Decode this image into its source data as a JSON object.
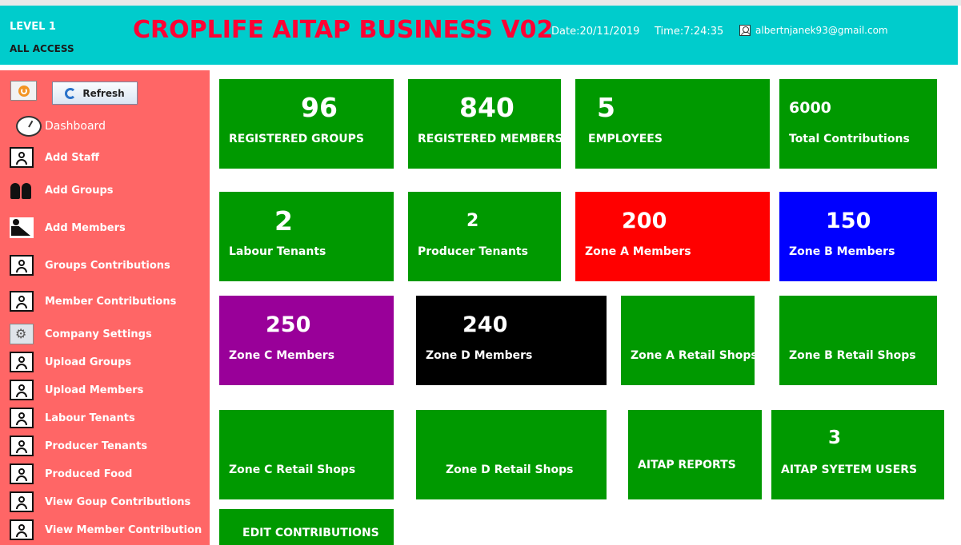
{
  "header": {
    "level": "LEVEL 1",
    "access": "ALL ACCESS",
    "title": "CROPLIFE AITAP BUSINESS V02",
    "date": "Date:20/11/2019",
    "time": "Time:7:24:35",
    "user_email": "albertnjanek93@gmail.com"
  },
  "sidebar": {
    "refresh_label": "Refresh",
    "dashboard_label": "Dashboard",
    "items": [
      {
        "label": "Add Staff",
        "icon": "folder-user-icon"
      },
      {
        "label": "Add Groups",
        "icon": "group-icon"
      },
      {
        "label": "Add Members",
        "icon": "worker-icon"
      },
      {
        "label": "Groups Contributions",
        "icon": "folder-user-icon"
      },
      {
        "label": "Member Contributions",
        "icon": "folder-user-icon"
      },
      {
        "label": "Company Settings",
        "icon": "gear-icon"
      },
      {
        "label": "Upload Groups",
        "icon": "folder-user-icon"
      },
      {
        "label": "Upload Members",
        "icon": "folder-user-icon"
      },
      {
        "label": "Labour Tenants",
        "icon": "folder-user-icon"
      },
      {
        "label": "Producer Tenants",
        "icon": "folder-user-icon"
      },
      {
        "label": "Produced Food",
        "icon": "folder-user-icon"
      },
      {
        "label": "View Goup Contributions",
        "icon": "folder-user-icon"
      },
      {
        "label": "View Member Contribution",
        "icon": "folder-user-icon"
      }
    ]
  },
  "tiles": {
    "registered_groups": {
      "value": "96",
      "label": "REGISTERED GROUPS"
    },
    "registered_members": {
      "value": "840",
      "label": "REGISTERED MEMBERS"
    },
    "employees": {
      "value": "5",
      "label": "EMPLOYEES"
    },
    "total_contributions": {
      "value": "6000",
      "label": "Total Contributions"
    },
    "labour_tenants": {
      "value": "2",
      "label": "Labour Tenants"
    },
    "producer_tenants": {
      "value": "2",
      "label": "Producer Tenants"
    },
    "zone_a_members": {
      "value": "200",
      "label": "Zone A Members"
    },
    "zone_b_members": {
      "value": "150",
      "label": "Zone B Members"
    },
    "zone_c_members": {
      "value": "250",
      "label": "Zone C Members"
    },
    "zone_d_members": {
      "value": "240",
      "label": "Zone D Members"
    },
    "zone_a_retail": {
      "label": "Zone A Retail Shops"
    },
    "zone_b_retail": {
      "label": "Zone B Retail Shops"
    },
    "zone_c_retail": {
      "label": "Zone C Retail Shops"
    },
    "zone_d_retail": {
      "label": "Zone D Retail Shops"
    },
    "aitap_reports": {
      "label": "AITAP REPORTS"
    },
    "system_users": {
      "value": "3",
      "label": "AITAP SYETEM USERS"
    },
    "edit_contributions": {
      "label": "EDIT CONTRIBUTIONS"
    }
  },
  "colors": {
    "header": "#00cccc",
    "title": "#ff0033",
    "sidebar": "#ff6666",
    "tile_green": "#009900",
    "zone_a": "#ff0000",
    "zone_b": "#0000ff",
    "zone_c": "#990099",
    "zone_d": "#000000"
  }
}
